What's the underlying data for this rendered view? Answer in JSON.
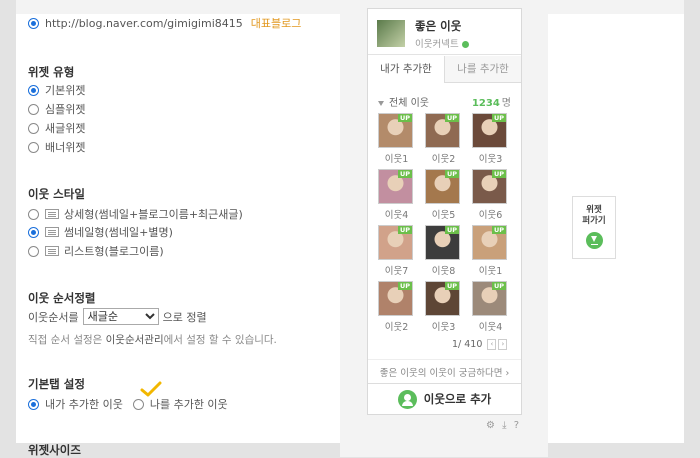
{
  "top_cut_text": "",
  "blog": {
    "url": "http://blog.naver.com/gimigimi8415",
    "link_label": "대표블로그"
  },
  "widget_type": {
    "title": "위젯 유형",
    "options": [
      "기본위젯",
      "심플위젯",
      "새글위젯",
      "배너위젯"
    ],
    "selected": 0
  },
  "neighbor_style": {
    "title": "이웃 스타일",
    "options": [
      "상세형(썸네일+블로그이름+최근새글)",
      "썸네일형(썸네일+별명)",
      "리스트형(블로그이름)"
    ],
    "selected": 1
  },
  "neighbor_sort": {
    "title": "이웃 순서정렬",
    "label": "이웃순서를",
    "select_value": "새글순",
    "suffix": "으로 정렬",
    "note_prefix": "직접 순서 설정은",
    "note_link": "이웃순서관리",
    "note_suffix": "에서 설정 할 수 있습니다."
  },
  "default_tab": {
    "title": "기본탭 설정",
    "options": [
      "내가 추가한 이웃",
      "나를 추가한 이웃"
    ],
    "selected": 0
  },
  "widget_size": {
    "title": "위젯사이즈"
  },
  "widget": {
    "title": "좋은 이웃",
    "subtitle": "이웃커넥트",
    "tabs": [
      "내가 추가한",
      "나를 추가한"
    ],
    "all_label": "전체 이웃",
    "count": "1234",
    "count_unit": "명",
    "neighbors": [
      {
        "label": "이웃1",
        "badge": "UP"
      },
      {
        "label": "이웃2",
        "badge": "UP"
      },
      {
        "label": "이웃3",
        "badge": "UP"
      },
      {
        "label": "이웃4",
        "badge": "UP"
      },
      {
        "label": "이웃5",
        "badge": "UP"
      },
      {
        "label": "이웃6",
        "badge": "UP"
      },
      {
        "label": "이웃7",
        "badge": "UP"
      },
      {
        "label": "이웃8",
        "badge": "UP"
      },
      {
        "label": "이웃1",
        "badge": "UP"
      },
      {
        "label": "이웃2",
        "badge": "UP"
      },
      {
        "label": "이웃3",
        "badge": "UP"
      },
      {
        "label": "이웃4",
        "badge": "UP"
      }
    ],
    "pager": "1/ 410",
    "more_link": "좋은 이웃의 이웃이 궁금하다면 ›",
    "add_button": "이웃으로 추가",
    "tools": "⚙ ⤓ ?"
  },
  "spread": {
    "label_line1": "위젯",
    "label_line2": "퍼가기"
  },
  "colors": {
    "accent_green": "#5bbd5b",
    "radio_blue": "#1a6fdb",
    "check_mark": "#f2b700"
  }
}
